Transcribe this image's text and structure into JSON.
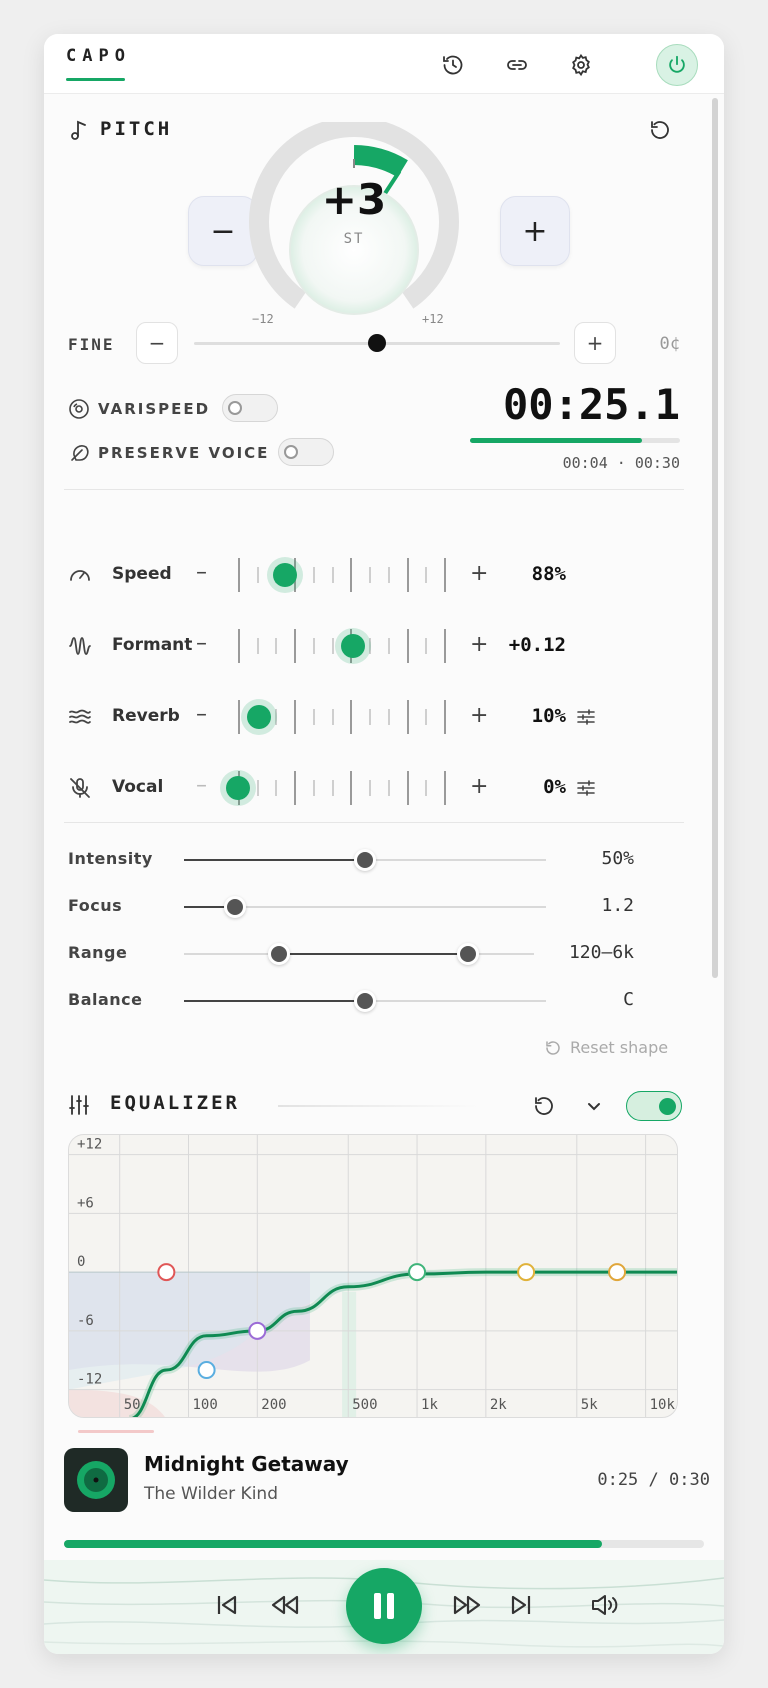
{
  "app": {
    "brand": "CAPO"
  },
  "pitch": {
    "title": "PITCH",
    "value": "+3",
    "unit": "ST",
    "min_label": "−12",
    "max_label": "+12",
    "minus_label": "−",
    "plus_label": "+",
    "fine": {
      "label": "FINE",
      "minus": "−",
      "plus": "+",
      "value": "0¢",
      "position_pct": 50
    }
  },
  "varispeed": {
    "label": "VARISPEED",
    "enabled": false
  },
  "preserve_voice": {
    "label": "PRESERVE VOICE",
    "enabled": false
  },
  "timer": {
    "display": "00:25.1",
    "elapsed": "00:04",
    "separator": "·",
    "total": "00:30",
    "progress_pct": 82
  },
  "effects": [
    {
      "label": "Speed",
      "icon": "speedometer-icon",
      "value": "88%",
      "position_pct": 23,
      "has_settings": false
    },
    {
      "label": "Formant",
      "icon": "waveform-icon",
      "value": "+0.12",
      "position_pct": 56,
      "has_settings": false
    },
    {
      "label": "Reverb",
      "icon": "waves-icon",
      "value": "10%",
      "position_pct": 10,
      "has_settings": true
    },
    {
      "label": "Vocal",
      "icon": "mic-off-icon",
      "value": "0%",
      "position_pct": 0,
      "has_settings": true
    }
  ],
  "shape": {
    "sliders": [
      {
        "label": "Intensity",
        "value": "50%",
        "position_pct": 50
      },
      {
        "label": "Focus",
        "value": "1.2",
        "position_pct": 14
      },
      {
        "label": "Range",
        "value": "120–6k",
        "range_pct": [
          27,
          81
        ]
      },
      {
        "label": "Balance",
        "value": "C",
        "position_pct": 50
      }
    ],
    "reset_label": "Reset shape"
  },
  "equalizer": {
    "title": "EQUALIZER",
    "enabled": true,
    "y_labels": [
      "+12",
      "+6",
      "0",
      "-6",
      "-12"
    ],
    "x_labels": [
      "50",
      "100",
      "200",
      "500",
      "1k",
      "2k",
      "5k",
      "10k"
    ]
  },
  "chart_data": {
    "type": "line",
    "title": "",
    "xlabel": "",
    "ylabel": "",
    "x_scale": "log",
    "ylim": [
      -15,
      14
    ],
    "x_ticks": [
      "50",
      "100",
      "200",
      "500",
      "1k",
      "2k",
      "5k",
      "10k"
    ],
    "y_ticks": [
      "+12",
      "+6",
      "0",
      "-6",
      "-12"
    ],
    "series": [
      {
        "values": [
          [
            55,
            -15
          ],
          [
            80,
            -10
          ],
          [
            120,
            -6.5
          ],
          [
            200,
            -6
          ],
          [
            300,
            -4
          ],
          [
            500,
            -1.5
          ],
          [
            1000,
            -0.2
          ],
          [
            2000,
            0
          ],
          [
            5000,
            0
          ],
          [
            20000,
            0
          ]
        ]
      }
    ],
    "band_points": [
      {
        "freq": 80,
        "gain": 0,
        "color": "#e05656"
      },
      {
        "freq": 120,
        "gain": -10,
        "color": "#5aaee0"
      },
      {
        "freq": 200,
        "gain": -6,
        "color": "#9b6bd6"
      },
      {
        "freq": 1000,
        "gain": 0,
        "color": "#3fb47a"
      },
      {
        "freq": 3000,
        "gain": 0,
        "color": "#e0b23a"
      },
      {
        "freq": 7500,
        "gain": 0,
        "color": "#e0a63a"
      }
    ]
  },
  "now_playing": {
    "title": "Midnight Getaway",
    "artist": "The Wilder Kind",
    "elapsed": "0:25",
    "separator": "/",
    "total": "0:30",
    "progress_pct": 84
  }
}
